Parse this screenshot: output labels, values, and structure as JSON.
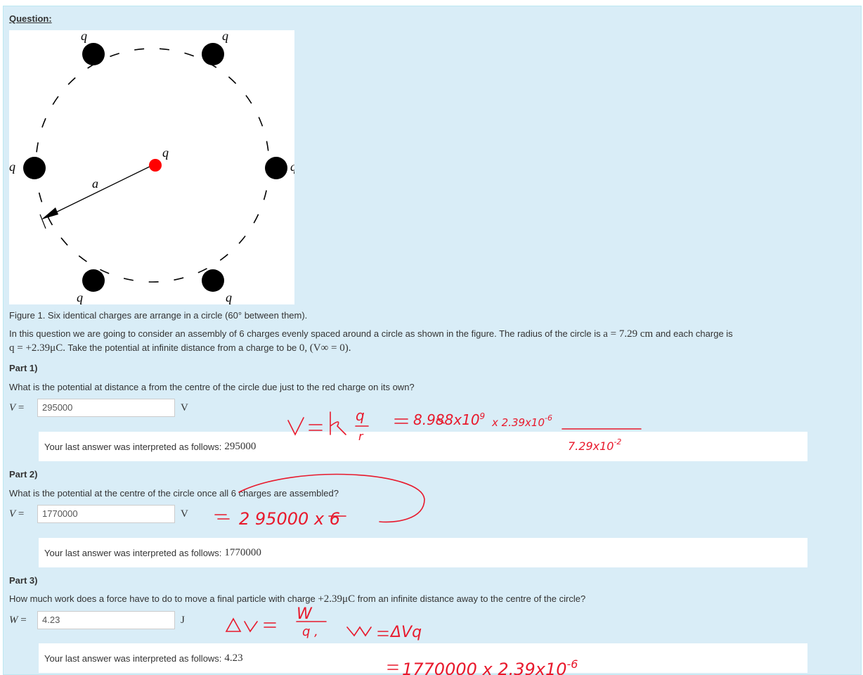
{
  "question_label": "Question:",
  "figure": {
    "charge_label": "q",
    "radius_label": "a",
    "caption": "Figure 1. Six identical charges are arrange in a circle (60° between them).",
    "center_charge_color": "#ff0000",
    "outer_charge_color": "#000000"
  },
  "intro": {
    "line1_text": "In this question we are going to consider an assembly of 6 charges evenly spaced around a circle as shown in the figure. The radius of the circle is",
    "radius_expr": "a = 7.29 cm",
    "line1_tail": "and each charge is",
    "charge_expr": "q = +2.39μC.",
    "line2_text": "Take the potential at infinite distance from a charge to be",
    "zero_expr": "0,",
    "vinf_expr": "(V∞ = 0)."
  },
  "parts": [
    {
      "title": "Part 1)",
      "question": "What is the potential at distance a from the centre of the circle due just to the red charge on its own?",
      "var": "V",
      "input_value": "295000",
      "unit": "V",
      "feedback_text": "Your last answer was interpreted as follows:",
      "feedback_value": "295000"
    },
    {
      "title": "Part 2)",
      "question": "What is the potential at the centre of the circle once all 6 charges are assembled?",
      "var": "V",
      "input_value": "1770000",
      "unit": "V",
      "feedback_text": "Your last answer was interpreted as follows:",
      "feedback_value": "1770000"
    },
    {
      "title": "Part 3)",
      "question_pre": "How much work does a force have to do to move a final particle with charge",
      "question_expr": "+2.39μC",
      "question_post": "from an infinite distance away to the centre of the circle?",
      "var": "W",
      "input_value": "4.23",
      "unit": "J",
      "feedback_text": "Your last answer was interpreted as follows:",
      "feedback_value": "4.23"
    }
  ],
  "handwriting": {
    "color": "#e8192c",
    "note1": "V = k q/r = 8.988x10^9 x 2.39x10^-6 / 7.29x10^-2",
    "note2": "= 295000 x 6",
    "note3": "ΔV = W/q, W = ΔVq = 1770000 x 2.39x10^-6"
  }
}
